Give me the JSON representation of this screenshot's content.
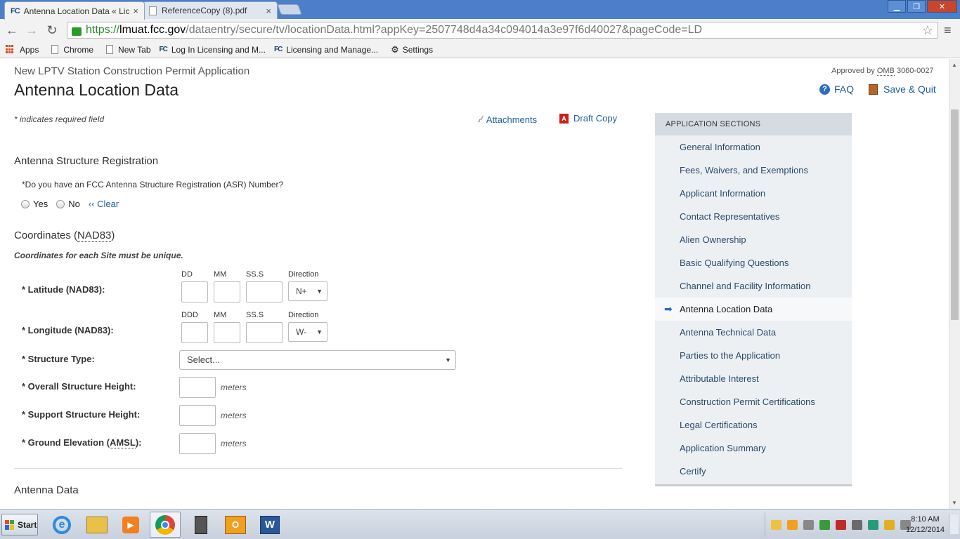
{
  "browser": {
    "tabs": [
      {
        "label": "Antenna Location Data « Lic",
        "favicon": "FC"
      },
      {
        "label": "ReferenceCopy (8).pdf"
      }
    ],
    "window_buttons": {
      "minimize": "▁",
      "maximize": "❐",
      "close": "✕"
    },
    "url": {
      "scheme": "https://",
      "host": "lmuat.fcc.gov",
      "path": "/dataentry/secure/tv/locationData.html?appKey=2507748d4a34c094014a3e97f6d40027&pageCode=LD"
    },
    "bookmarks": [
      {
        "label": "Apps",
        "icon": "apps-grid-icon"
      },
      {
        "label": "Chrome",
        "icon": "page-icon"
      },
      {
        "label": "New Tab",
        "icon": "page-icon"
      },
      {
        "label": "Log In Licensing and M...",
        "icon": "fcc-icon"
      },
      {
        "label": "Licensing and Manage...",
        "icon": "fcc-icon"
      },
      {
        "label": "Settings",
        "icon": "gear-icon"
      }
    ]
  },
  "header": {
    "subtitle": "New LPTV Station Construction Permit Application",
    "title": "Antenna Location Data",
    "omb_prefix": "Approved by ",
    "omb_abbr": "OMB",
    "omb_number": " 3060-0027",
    "faq_label": "FAQ",
    "save_quit_label": "Save & Quit"
  },
  "toolbar": {
    "required_note": "* indicates required field",
    "attachments_label": "Attachments",
    "draft_copy_label": "Draft Copy",
    "pdf_glyph": "A"
  },
  "asr": {
    "heading": "Antenna Structure Registration",
    "question": "*Do you have an FCC Antenna Structure Registration (ASR) Number?",
    "yes_label": "Yes",
    "no_label": "No",
    "clear_label": "‹‹ Clear"
  },
  "coordinates": {
    "heading_prefix": "Coordinates (",
    "heading_abbr": "NAD83",
    "heading_suffix": ")",
    "unique_note": "Coordinates for each Site must be unique.",
    "latitude": {
      "label": "* Latitude (NAD83):",
      "col1": "DD",
      "col2": "MM",
      "col3": "SS.S",
      "col4": "Direction",
      "direction": "N+"
    },
    "longitude": {
      "label": "* Longitude (NAD83):",
      "col1": "DDD",
      "col2": "MM",
      "col3": "SS.S",
      "col4": "Direction",
      "direction": "W-"
    }
  },
  "structure": {
    "type_label": "* Structure Type:",
    "type_value": "Select...",
    "overall_label": "* Overall Structure Height:",
    "support_label": "* Support Structure Height:",
    "ground_label_prefix": "* Ground Elevation (",
    "ground_label_abbr": "AMSL",
    "ground_label_suffix": "):",
    "unit": "meters"
  },
  "antenna_data": {
    "heading": "Antenna Data"
  },
  "sidebar": {
    "heading": "APPLICATION SECTIONS",
    "items": [
      {
        "label": "General Information"
      },
      {
        "label": "Fees, Waivers, and Exemptions"
      },
      {
        "label": "Applicant Information"
      },
      {
        "label": "Contact Representatives"
      },
      {
        "label": "Alien Ownership"
      },
      {
        "label": "Basic Qualifying Questions"
      },
      {
        "label": "Channel and Facility Information"
      },
      {
        "label": "Antenna Location Data",
        "active": true
      },
      {
        "label": "Antenna Technical Data"
      },
      {
        "label": "Parties to the Application"
      },
      {
        "label": "Attributable Interest"
      },
      {
        "label": "Construction Permit Certifications"
      },
      {
        "label": "Legal Certifications"
      },
      {
        "label": "Application Summary"
      },
      {
        "label": "Certify"
      }
    ]
  },
  "taskbar": {
    "start_label": "Start",
    "ie_glyph": "e",
    "outlook_glyph": "O",
    "word_glyph": "W",
    "clock_time": "8:10 AM",
    "clock_date": "12/12/2014"
  }
}
